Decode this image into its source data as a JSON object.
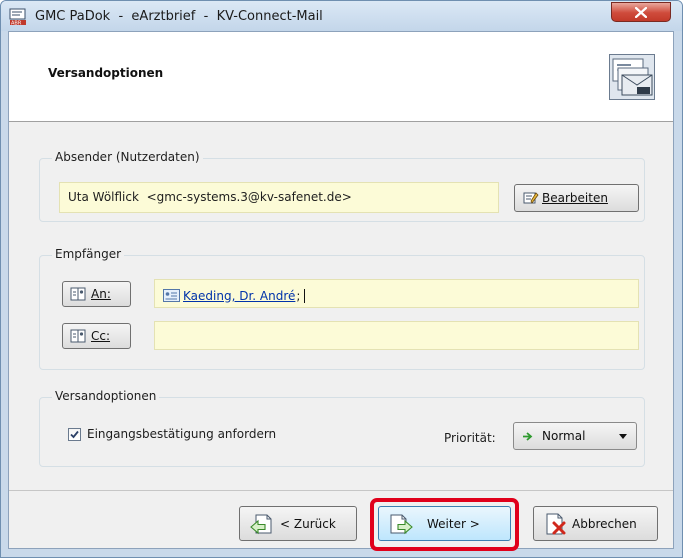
{
  "window": {
    "title": "GMC PaDok  -  eArztbrief  -  KV-Connect-Mail"
  },
  "header": {
    "title": "Versandoptionen"
  },
  "absender": {
    "group_title": "Absender (Nutzerdaten)",
    "value": "Uta Wölflick  <gmc-systems.3@kv-safenet.de>",
    "edit_button": "Bearbeiten"
  },
  "empfaenger": {
    "group_title": "Empfänger",
    "an_button": "An:",
    "an_value": "Kaeding, Dr. André",
    "an_separator": ";",
    "cc_button": "Cc:",
    "cc_value": ""
  },
  "versand": {
    "group_title": "Versandoptionen",
    "checkbox_label": "Eingangsbestätigung anfordern",
    "checkbox_checked": true,
    "priority_label": "Priorität:",
    "priority_value": "Normal"
  },
  "footer": {
    "back": "< Zurück",
    "next": "Weiter >",
    "cancel": "Abbrechen"
  },
  "colors": {
    "highlight": "#e0001b",
    "field_bg": "#fcfbd7",
    "link": "#0033aa"
  }
}
